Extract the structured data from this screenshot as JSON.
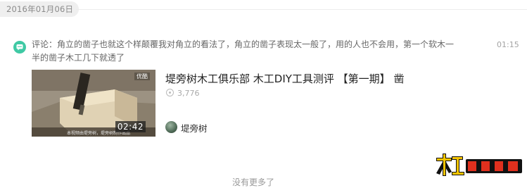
{
  "date_header": {
    "date": "2016年01月06日"
  },
  "comment": {
    "text": "评论：角立的凿子也就这个样颠覆我对角立的看法了，角立的凿子表现太一般了，用的人也不会用，第一个软木一半的凿子木工几下就透了",
    "time": "01:15",
    "icon": "comment-bubble-icon",
    "icon_color": "#3fc9a4"
  },
  "video": {
    "title": "堤旁树木工俱乐部 木工DIY工具测评 【第一期】 凿",
    "views": "3,776",
    "duration": "02:42",
    "badge": "优酷",
    "thumb_caption": "本视频由堤旁树，堤旁树制作出品",
    "author": "堤旁树"
  },
  "bottom_text": "没有更多了",
  "logo": {
    "text": "木工爱好者"
  }
}
